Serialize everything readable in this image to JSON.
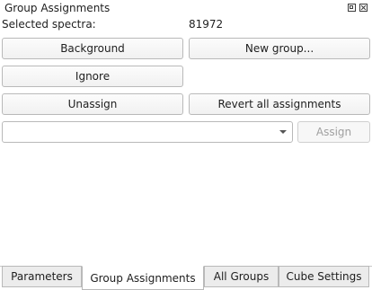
{
  "panel": {
    "title": "Group Assignments",
    "selected_label": "Selected spectra:",
    "selected_value": "81972"
  },
  "buttons": {
    "background": "Background",
    "new_group": "New group...",
    "ignore": "Ignore",
    "unassign": "Unassign",
    "revert_all": "Revert all assignments",
    "assign": "Assign"
  },
  "group_select": {
    "value": ""
  },
  "tabs": [
    {
      "label": "Parameters",
      "active": false
    },
    {
      "label": "Group Assignments",
      "active": true
    },
    {
      "label": "All Groups",
      "active": false
    },
    {
      "label": "Cube Settings",
      "active": false
    }
  ],
  "icons": {
    "float": "float-window-icon",
    "close": "close-icon",
    "dropdown": "chevron-down-icon"
  }
}
